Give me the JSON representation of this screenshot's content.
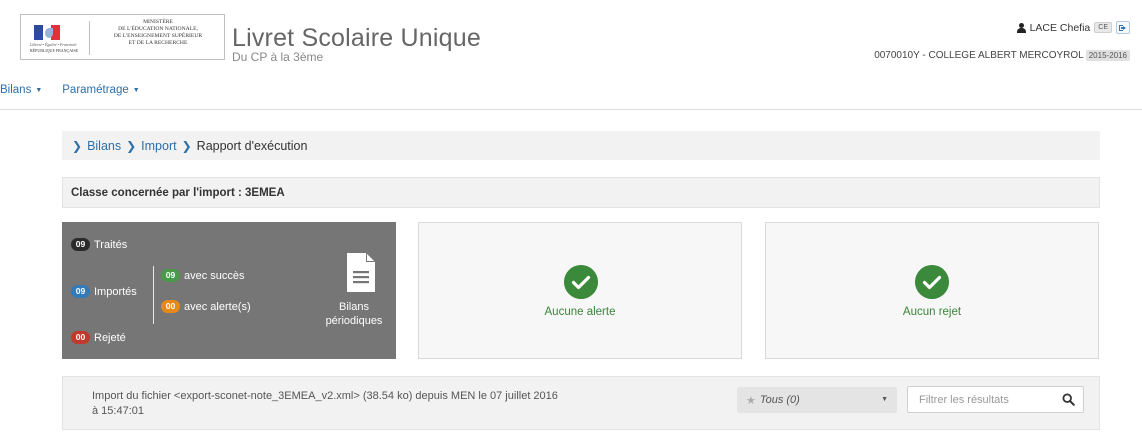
{
  "header": {
    "motto": "Liberté • Égalité • Fraternité",
    "republique": "RÉPUBLIQUE FRANÇAISE",
    "ministry_lines": [
      "MINISTÈRE",
      "DE L'ÉDUCATION NATIONALE,",
      "DE L'ENSEIGNEMENT SUPÉRIEUR",
      "ET DE LA RECHERCHE"
    ],
    "app_title": "Livret Scolaire Unique",
    "app_subtitle": "Du CP à la 3ème",
    "user_name": "LACE Chefia",
    "user_role": "CE",
    "school": "0070010Y - COLLEGE ALBERT MERCOYROL",
    "school_year": "2015-2016"
  },
  "nav": {
    "items": [
      {
        "label": "Bilans"
      },
      {
        "label": "Paramétrage"
      }
    ]
  },
  "breadcrumb": {
    "items": [
      "Bilans",
      "Import",
      "Rapport d'exécution"
    ]
  },
  "classe": {
    "label": "Classe concernée par l'import : 3EMEA"
  },
  "stats": {
    "traites": {
      "count": "09",
      "label": "Traités"
    },
    "importes": {
      "count": "09",
      "label": "Importés"
    },
    "succes": {
      "count": "09",
      "label": "avec succès"
    },
    "alertes": {
      "count": "00",
      "label": "avec alerte(s)"
    },
    "rejete": {
      "count": "00",
      "label": "Rejeté"
    },
    "bilans_label": "Bilans périodiques"
  },
  "cards": {
    "alert_label": "Aucune alerte",
    "reject_label": "Aucun rejet"
  },
  "import": {
    "text": "Import du fichier <export-sconet-note_3EMEA_v2.xml> (38.54 ko) depuis MEN le 07 juillet 2016 à 15:47:01",
    "filter_value": "Tous (0)",
    "search_placeholder": "Filtrer les résultats"
  },
  "colors": {
    "accent": "#2f6fa8",
    "success": "#3b8a3b",
    "warning": "#e68a17",
    "danger": "#c0392b",
    "panel": "#767676"
  }
}
